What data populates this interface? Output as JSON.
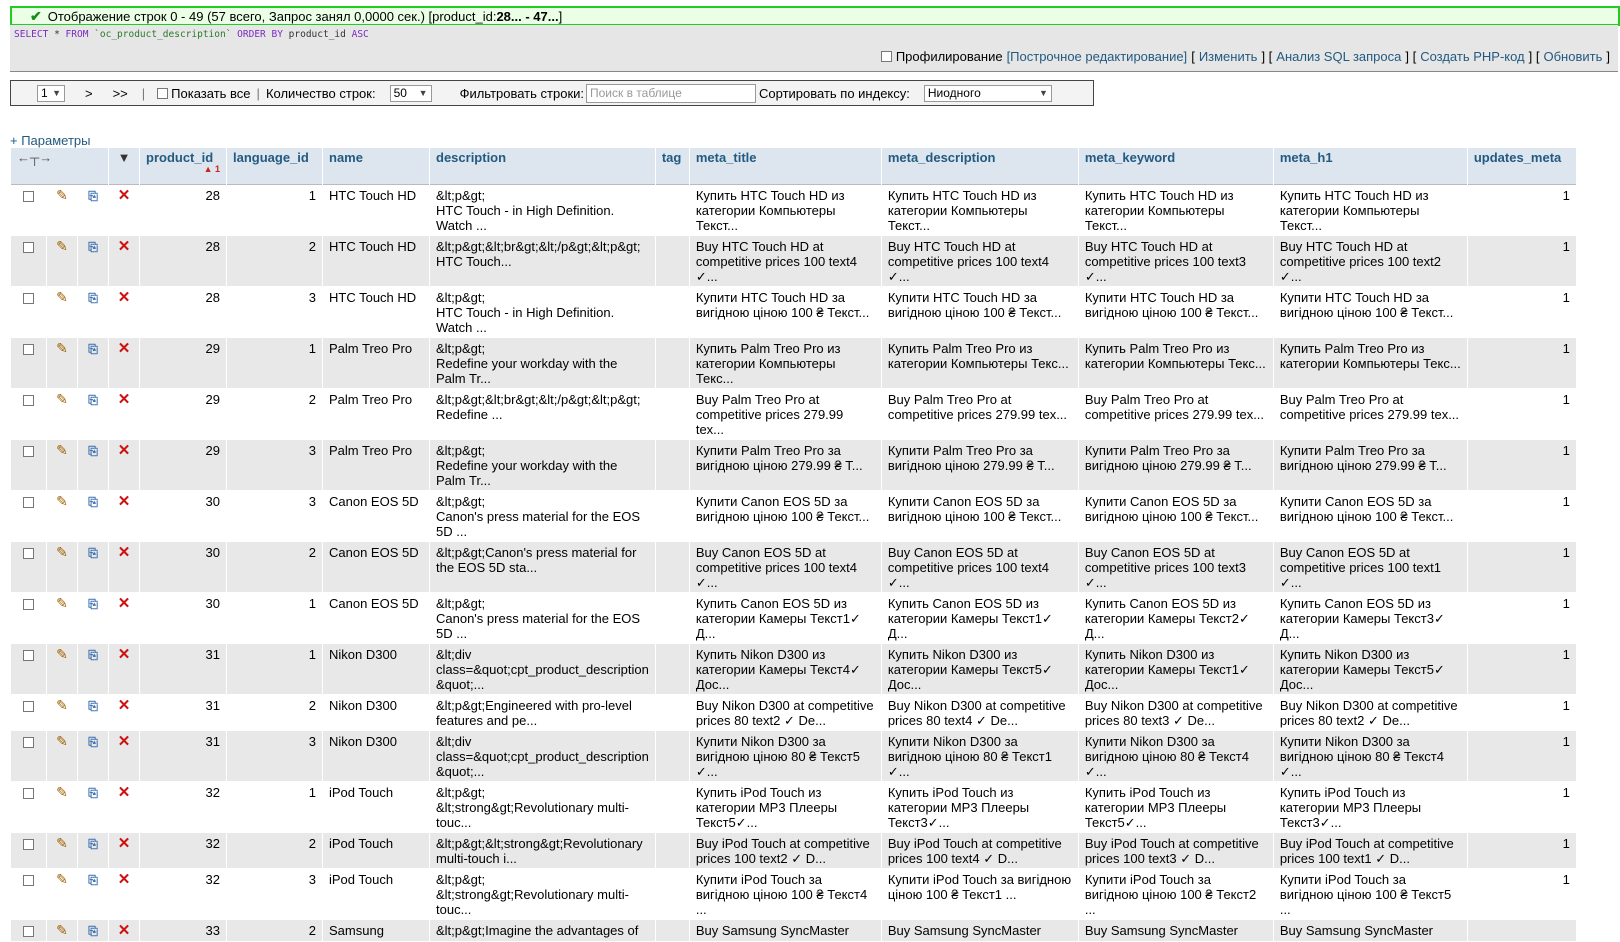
{
  "message": {
    "text": "Отображение строк 0 - 49 (57 всего, Запрос занял 0,0000 сек.) [product_id: ",
    "bold_range": "28... - 47...",
    "close": "]"
  },
  "sql": {
    "select": "SELECT",
    "star": "*",
    "from": "FROM",
    "table": "`oc_product_description`",
    "order": "ORDER BY",
    "col": "product_id",
    "asc": "ASC"
  },
  "sql_actions": {
    "profiling": "Профилирование",
    "inline_edit": "[Построчное редактирование]",
    "edit": "Изменить",
    "analyze": "Анализ SQL запроса",
    "php": "Создать PHP-код",
    "refresh": "Обновить"
  },
  "nav": {
    "page": "1",
    "next": ">",
    "last": ">>",
    "show_all": "Показать все",
    "rows_label": "Количество строк:",
    "rows_value": "50",
    "filter_label": "Фильтровать строки:",
    "filter_placeholder": "Поиск в таблице",
    "sort_label": "Сортировать по индексу:",
    "sort_value": "Ниодного"
  },
  "params_link": "+ Параметры",
  "columns": [
    "product_id",
    "language_id",
    "name",
    "description",
    "tag",
    "meta_title",
    "meta_description",
    "meta_keyword",
    "meta_h1",
    "updates_meta"
  ],
  "sort_indicator": "▲ 1",
  "rows": [
    [
      "28",
      "1",
      "HTC Touch HD",
      "&lt;p&gt;\nHTC Touch - in High Definition. Watch ...",
      "",
      "Купить HTC Touch HD из категории Компьютеры  Текст...",
      "Купить HTC Touch HD из категории Компьютеры  Текст...",
      "Купить HTC Touch HD из категории Компьютеры  Текст...",
      "Купить HTC Touch HD из категории Компьютеры  Текст...",
      "1"
    ],
    [
      "28",
      "2",
      "HTC Touch HD",
      "&lt;p&gt;&lt;br&gt;&lt;/p&gt;&lt;p&gt;\nHTC Touch...",
      "",
      "Buy HTC Touch HD at competitive prices 100 text4 ✓...",
      "Buy HTC Touch HD at competitive prices 100 text4 ✓...",
      "Buy HTC Touch HD at competitive prices 100 text3 ✓...",
      "Buy HTC Touch HD at competitive prices 100 text2 ✓...",
      "1"
    ],
    [
      "28",
      "3",
      "HTC Touch HD",
      "&lt;p&gt;\nHTC Touch - in High Definition. Watch ...",
      "",
      "Купити HTC Touch HD за вигідною ціною 100 ₴ Текст...",
      "Купити HTC Touch HD за вигідною ціною 100 ₴ Текст...",
      "Купити HTC Touch HD за вигідною ціною 100 ₴ Текст...",
      "Купити HTC Touch HD за вигідною ціною 100 ₴ Текст...",
      "1"
    ],
    [
      "29",
      "1",
      "Palm Treo Pro",
      "&lt;p&gt;\nRedefine your workday with the Palm Tr...",
      "",
      "Купить Palm Treo Pro из категории Компьютеры  Текс...",
      "Купить Palm Treo Pro из категории Компьютеры  Текс...",
      "Купить Palm Treo Pro из категории Компьютеры  Текс...",
      "Купить Palm Treo Pro из категории Компьютеры  Текс...",
      "1"
    ],
    [
      "29",
      "2",
      "Palm Treo Pro",
      "&lt;p&gt;&lt;br&gt;&lt;/p&gt;&lt;p&gt;\nRedefine ...",
      "",
      "Buy Palm Treo Pro at competitive prices 279.99 tex...",
      "Buy Palm Treo Pro at competitive prices 279.99 tex...",
      "Buy Palm Treo Pro at competitive prices 279.99 tex...",
      "Buy Palm Treo Pro at competitive prices 279.99 tex...",
      "1"
    ],
    [
      "29",
      "3",
      "Palm Treo Pro",
      "&lt;p&gt;\nRedefine your workday with the Palm Tr...",
      "",
      "Купити Palm Treo Pro за вигідною ціною 279.99 ₴  Т...",
      "Купити Palm Treo Pro за вигідною ціною 279.99 ₴  Т...",
      "Купити Palm Treo Pro за вигідною ціною 279.99 ₴  Т...",
      "Купити Palm Treo Pro за вигідною ціною 279.99 ₴  Т...",
      "1"
    ],
    [
      "30",
      "3",
      "Canon EOS 5D",
      "&lt;p&gt;\nCanon's press material for the EOS 5D ...",
      "",
      "Купити Canon EOS 5D за вигідною ціною 100 ₴ Текст...",
      "Купити Canon EOS 5D за вигідною ціною 100 ₴ Текст...",
      "Купити Canon EOS 5D за вигідною ціною 100 ₴ Текст...",
      "Купити Canon EOS 5D за вигідною ціною 100 ₴ Текст...",
      "1"
    ],
    [
      "30",
      "2",
      "Canon EOS 5D",
      "&lt;p&gt;Canon's press material for the EOS 5D sta...",
      "",
      "Buy Canon EOS 5D at competitive prices 100 text4 ✓...",
      "Buy Canon EOS 5D at competitive prices 100 text4 ✓...",
      "Buy Canon EOS 5D at competitive prices 100 text3 ✓...",
      "Buy Canon EOS 5D at competitive prices 100 text1 ✓...",
      "1"
    ],
    [
      "30",
      "1",
      "Canon EOS 5D",
      "&lt;p&gt;\nCanon's press material for the EOS 5D ...",
      "",
      "Купить Canon EOS 5D из категории Камеры  Текст1✓ Д...",
      "Купить Canon EOS 5D из категории Камеры  Текст1✓ Д...",
      "Купить Canon EOS 5D из категории Камеры  Текст2✓ Д...",
      "Купить Canon EOS 5D из категории Камеры  Текст3✓ Д...",
      "1"
    ],
    [
      "31",
      "1",
      "Nikon D300",
      "&lt;div class=&quot;cpt_product_description &quot;...",
      "",
      "Купить Nikon D300 из категории Камеры  Текст4✓ Дос...",
      "Купить Nikon D300 из категории Камеры  Текст5✓ Дос...",
      "Купить Nikon D300 из категории Камеры  Текст1✓ Дос...",
      "Купить Nikon D300 из категории Камеры  Текст5✓ Дос...",
      "1"
    ],
    [
      "31",
      "2",
      "Nikon D300",
      "&lt;p&gt;Engineered with pro-level features and pe...",
      "",
      "Buy Nikon D300 at competitive prices 80 text2 ✓ De...",
      "Buy Nikon D300 at competitive prices 80 text4 ✓ De...",
      "Buy Nikon D300 at competitive prices 80 text3 ✓ De...",
      "Buy Nikon D300 at competitive prices 80 text2 ✓ De...",
      "1"
    ],
    [
      "31",
      "3",
      "Nikon D300",
      "&lt;div class=&quot;cpt_product_description &quot;...",
      "",
      "Купити Nikon D300 за вигідною ціною 80 ₴  Текст5 ✓...",
      "Купити Nikon D300 за вигідною ціною 80 ₴  Текст1 ✓...",
      "Купити Nikon D300 за вигідною ціною 80 ₴  Текст4 ✓...",
      "Купити Nikon D300 за вигідною ціною 80 ₴  Текст4 ✓...",
      "1"
    ],
    [
      "32",
      "1",
      "iPod Touch",
      "&lt;p&gt;\n&lt;strong&gt;Revolutionary multi-touc...",
      "",
      "Купить iPod Touch из категории MP3 Плееры  Текст5✓...",
      "Купить iPod Touch из категории MP3 Плееры  Текст3✓...",
      "Купить iPod Touch из категории MP3 Плееры  Текст5✓...",
      "Купить iPod Touch из категории MP3 Плееры  Текст3✓...",
      "1"
    ],
    [
      "32",
      "2",
      "iPod Touch",
      "&lt;p&gt;&lt;strong&gt;Revolutionary multi-touch i...",
      "",
      "Buy iPod Touch at competitive prices 100 text2 ✓ D...",
      "Buy iPod Touch at competitive prices 100 text4 ✓ D...",
      "Buy iPod Touch at competitive prices 100 text3 ✓ D...",
      "Buy iPod Touch at competitive prices 100 text1 ✓ D...",
      "1"
    ],
    [
      "32",
      "3",
      "iPod Touch",
      "&lt;p&gt;\n&lt;strong&gt;Revolutionary multi-touc...",
      "",
      "Купити iPod Touch за вигідною ціною 100 ₴  Текст4 ...",
      "Купити iPod Touch за вигідною ціною 100 ₴  Текст1 ...",
      "Купити iPod Touch за вигідною ціною 100 ₴  Текст2 ...",
      "Купити iPod Touch за вигідною ціною 100 ₴  Текст5 ...",
      "1"
    ],
    [
      "33",
      "2",
      "Samsung",
      "&lt;p&gt;Imagine the advantages of",
      "",
      "Buy Samsung SyncMaster",
      "Buy Samsung SyncMaster",
      "Buy Samsung SyncMaster",
      "Buy Samsung SyncMaster",
      ""
    ]
  ]
}
